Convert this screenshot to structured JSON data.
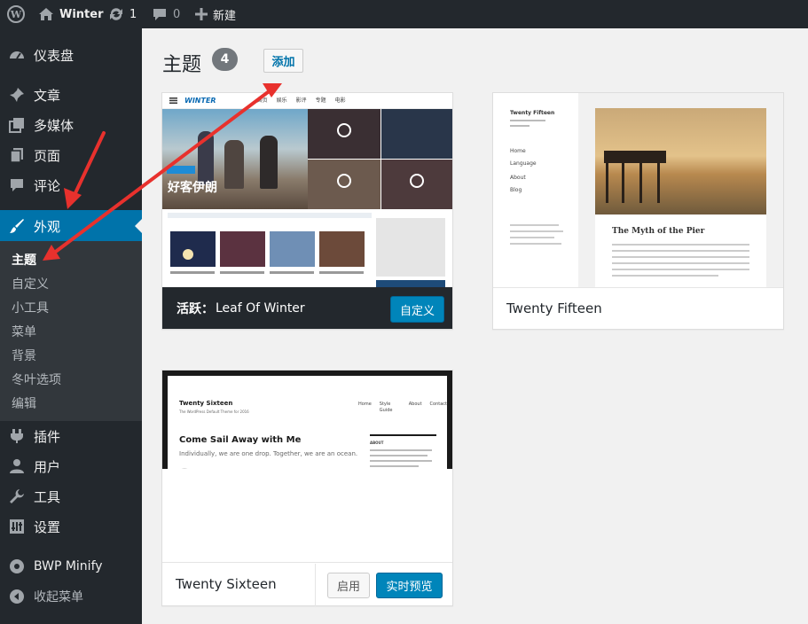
{
  "adminbar": {
    "site_name": "Winter",
    "updates_count": "1",
    "comments_count": "0",
    "new_label": "新建"
  },
  "sidebar": {
    "items": [
      {
        "label": "仪表盘",
        "icon": "dashboard-icon"
      },
      {
        "label": "文章",
        "icon": "pin-icon"
      },
      {
        "label": "多媒体",
        "icon": "media-icon"
      },
      {
        "label": "页面",
        "icon": "page-icon"
      },
      {
        "label": "评论",
        "icon": "comment-icon"
      },
      {
        "label": "外观",
        "icon": "paintbrush-icon"
      },
      {
        "label": "插件",
        "icon": "plugin-icon"
      },
      {
        "label": "用户",
        "icon": "user-icon"
      },
      {
        "label": "工具",
        "icon": "wrench-icon"
      },
      {
        "label": "设置",
        "icon": "settings-icon"
      },
      {
        "label": "BWP Minify",
        "icon": "bwp-icon"
      },
      {
        "label": "收起菜单",
        "icon": "collapse-icon"
      }
    ],
    "submenu": [
      "主题",
      "自定义",
      "小工具",
      "菜单",
      "背景",
      "冬叶选项",
      "编辑"
    ]
  },
  "page": {
    "title": "主题",
    "count": "4",
    "add_label": "添加"
  },
  "themes": {
    "active": {
      "prefix": "活跃：",
      "name": "Leaf Of Winter",
      "customize_label": "自定义",
      "preview": {
        "logo": "WINTER",
        "nav": [
          "首页",
          "娱乐",
          "影评",
          "专题",
          "电影"
        ],
        "hero_text": "好客伊朗"
      }
    },
    "fifteen": {
      "name": "Twenty Fifteen",
      "preview": {
        "site_title": "Twenty Fifteen",
        "post_title": "The Myth of the Pier",
        "menu": [
          "Home",
          "Language",
          "About",
          "Blog"
        ]
      }
    },
    "sixteen": {
      "name": "Twenty Sixteen",
      "activate_label": "启用",
      "preview_label": "实时预览",
      "preview": {
        "site_title": "Twenty Sixteen",
        "tagline": "The WordPress Default Theme for 2016",
        "nav": [
          "Home",
          "Style Guide",
          "About",
          "Contact"
        ],
        "post_title": "Come Sail Away with Me",
        "post_intro": "Individually, we are one drop. Together, we are an ocean.",
        "widget_title": "ABOUT"
      }
    }
  },
  "colors": {
    "accent": "#0073aa",
    "annotation": "#e8312d"
  }
}
